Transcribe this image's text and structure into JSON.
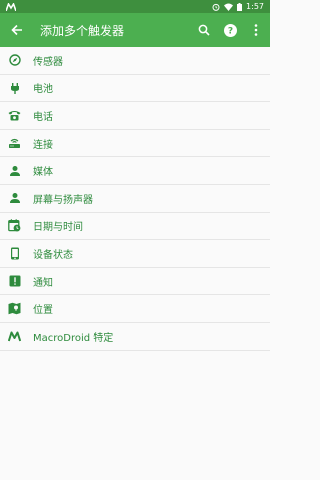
{
  "status_bar": {
    "time": "1:57",
    "left_icon": "macrodroid-icon"
  },
  "app_bar": {
    "title": "添加多个触发器",
    "back_icon": "arrow-back-icon",
    "search_icon": "search-icon",
    "help_icon": "help-icon",
    "more_icon": "more-vert-icon"
  },
  "triggers": [
    {
      "label": "传感器",
      "icon": "compass-icon"
    },
    {
      "label": "电池",
      "icon": "power-plug-icon"
    },
    {
      "label": "电话",
      "icon": "phone-icon"
    },
    {
      "label": "连接",
      "icon": "router-icon"
    },
    {
      "label": "媒体",
      "icon": "person-icon"
    },
    {
      "label": "屏幕与扬声器",
      "icon": "person-icon"
    },
    {
      "label": "日期与时间",
      "icon": "calendar-clock-icon"
    },
    {
      "label": "设备状态",
      "icon": "phone-device-icon"
    },
    {
      "label": "通知",
      "icon": "alert-icon"
    },
    {
      "label": "位置",
      "icon": "map-icon"
    },
    {
      "label": "MacroDroid 特定",
      "icon": "macrodroid-icon"
    }
  ],
  "colors": {
    "primary": "#4caf50",
    "primary_dark": "#3e8f3e",
    "accent_text": "#2e8b3d"
  }
}
